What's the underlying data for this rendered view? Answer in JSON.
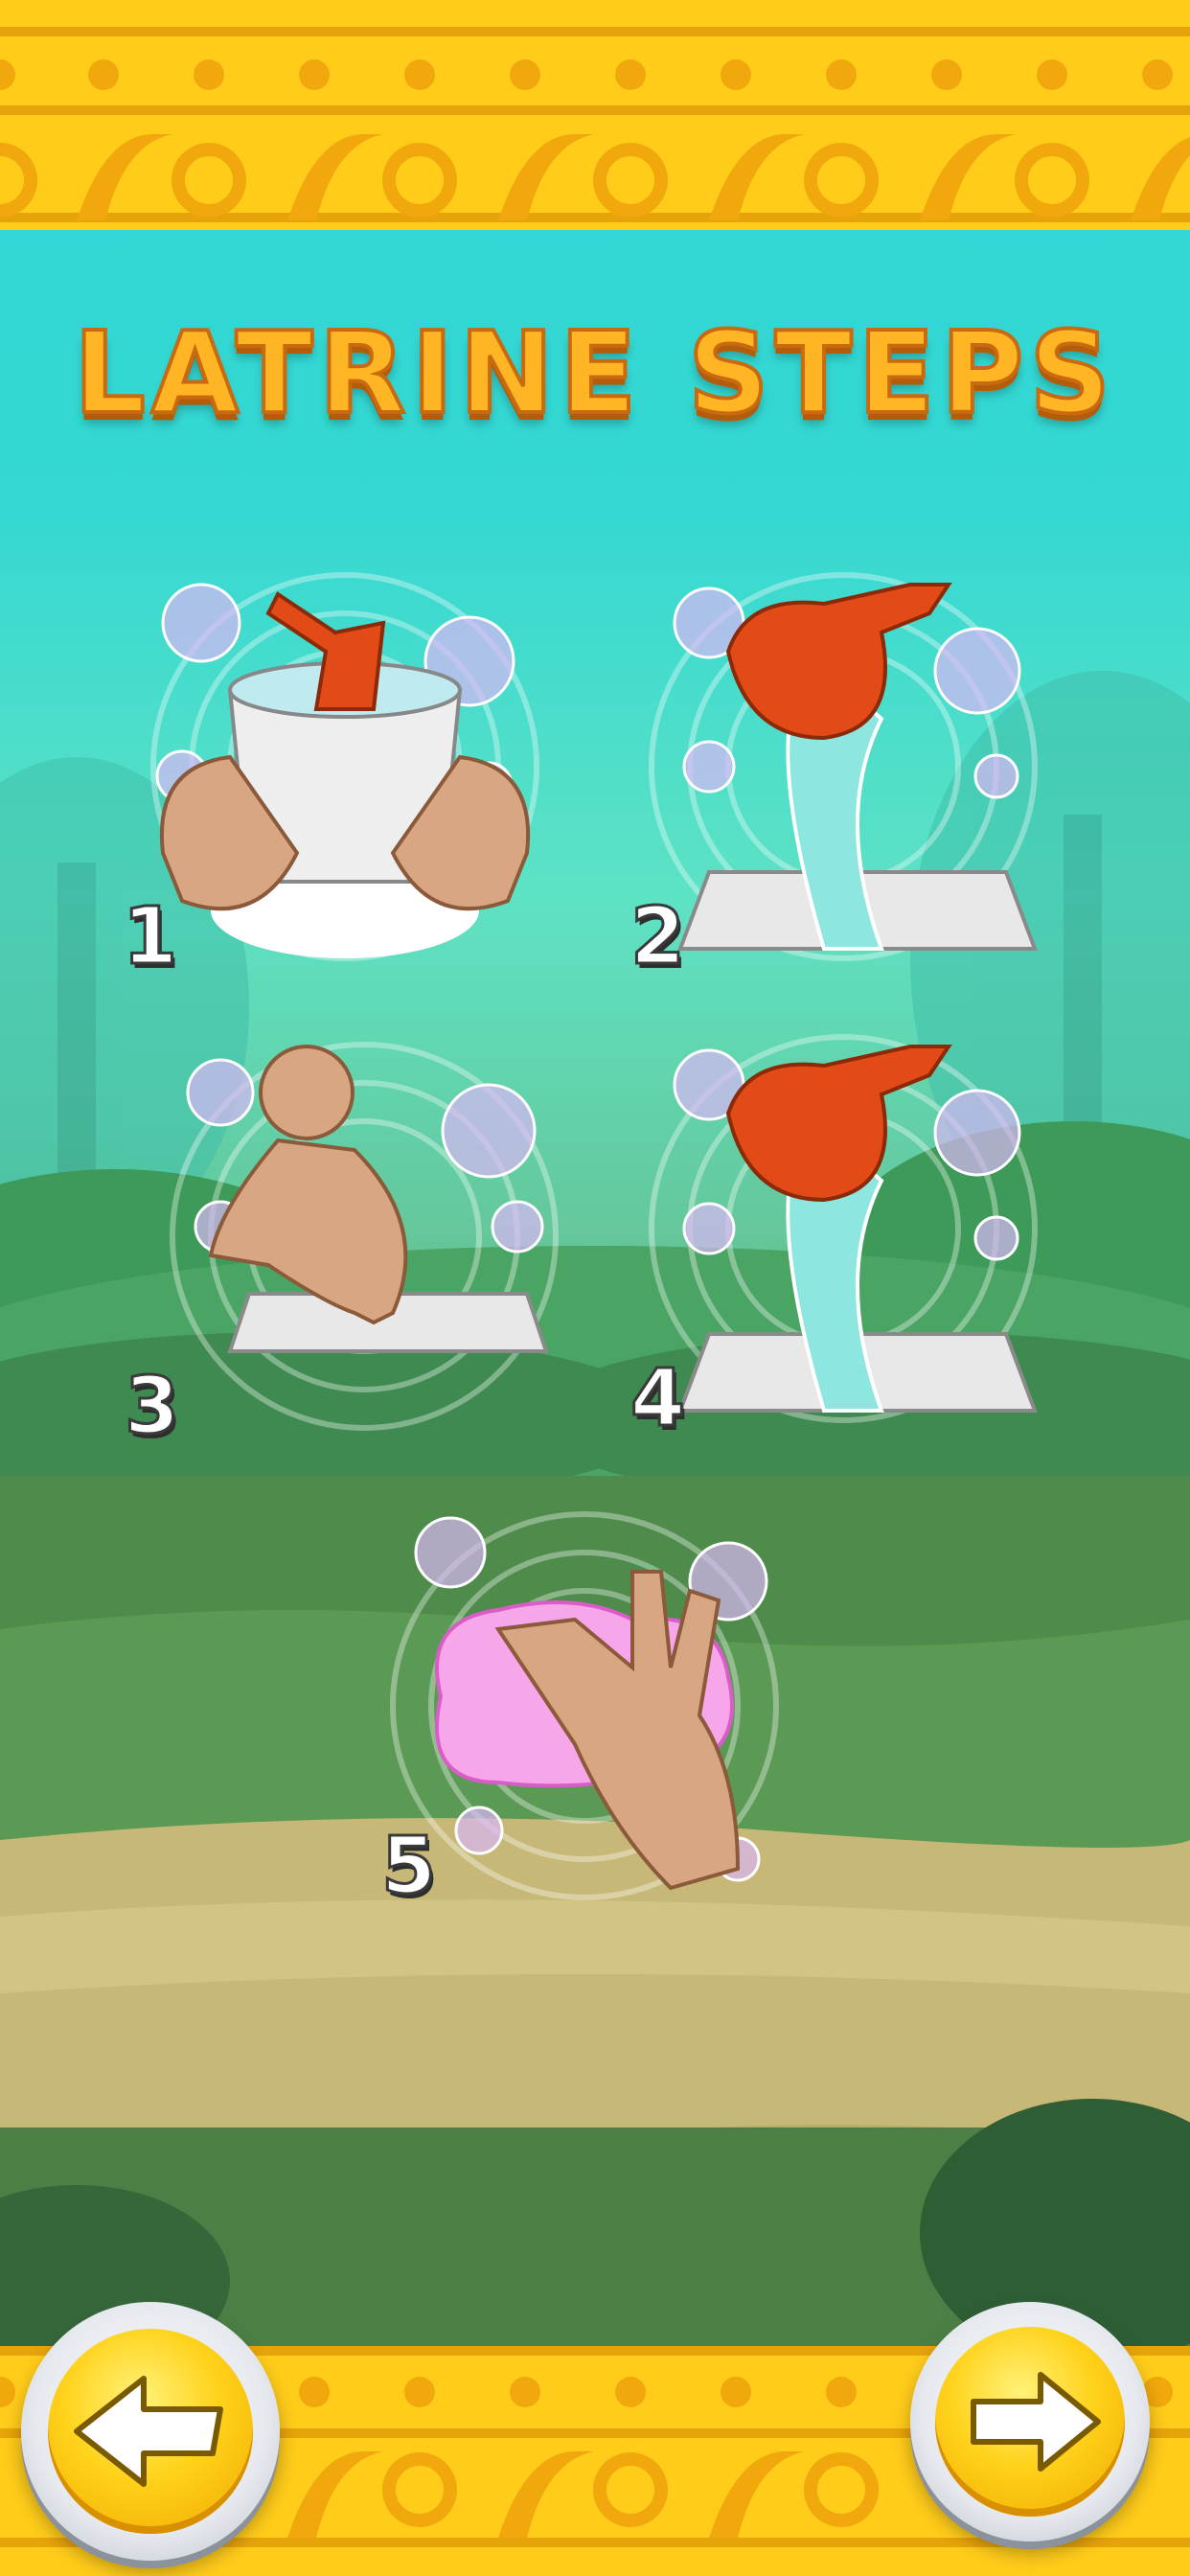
{
  "title": "LATRINE STEPS",
  "steps": [
    {
      "number": "1",
      "icon": "bucket-scoop-icon"
    },
    {
      "number": "2",
      "icon": "pour-water-toilet-icon"
    },
    {
      "number": "3",
      "icon": "squat-toilet-icon"
    },
    {
      "number": "4",
      "icon": "pour-water-toilet-icon"
    },
    {
      "number": "5",
      "icon": "wash-hands-soap-icon"
    }
  ],
  "navigation": {
    "back_icon": "arrow-left-icon",
    "next_icon": "arrow-right-icon"
  },
  "colors": {
    "banner": "#ffcc1a",
    "title_fill": "#ffb524",
    "sky": "#2ed6d6"
  }
}
